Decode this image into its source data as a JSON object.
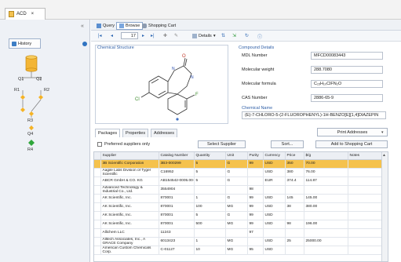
{
  "tab": {
    "title": "ACD",
    "close": "×"
  },
  "left": {
    "collapse": "«",
    "history_label": "History",
    "nodes": {
      "q1": "Q1",
      "q2": "Q2",
      "r1": "R1",
      "r2": "R2",
      "r3": "R3",
      "q4": "Q4",
      "r4": "R4"
    }
  },
  "toolbar": {
    "query": "Query",
    "browse": "Browse",
    "cart": "Shopping Cart"
  },
  "nav": {
    "first": "|◂",
    "prev": "◂",
    "page": "17",
    "next": "▸",
    "last": "▸|",
    "details": "Details"
  },
  "structure": {
    "label": "Chemical Structure"
  },
  "details": {
    "group": "Compound Details",
    "mdl_label": "MDL Number",
    "mdl_value": "MFCD00083443",
    "mw_label": "Molecular weight",
    "mw_value": "288.7080",
    "mf_label": "Molecular formula",
    "mf_value": "C₁₅H₁₀ClFN₂O",
    "cas_label": "CAS Number",
    "cas_value": "2886-65-9",
    "name_group": "Chemical Name",
    "name_value": "(E)-7-CHLORO-5-(2-FLUOROPHENYL)-1H-BENZO[E][1,4]DIAZEPIN"
  },
  "lower_tabs": {
    "packages": "Packages",
    "properties": "Properties",
    "addresses": "Addresses"
  },
  "actions": {
    "print": "Print Addresses",
    "preferred": "Preferred suppliers only",
    "select_supplier": "Select Supplier",
    "sort": "Sort...",
    "add_cart": "Add to Shopping Cart"
  },
  "table": {
    "headers": [
      "Supplier",
      "Catalog Number",
      "Quantity",
      "Unit",
      "Purity",
      "Currency",
      "Price",
      "$/g",
      "Notes"
    ],
    "rows": [
      [
        "3B Scientific Corporation",
        "3B3-000299",
        "5",
        "G",
        "99",
        "USD",
        "350",
        "70.00",
        ""
      ],
      [
        "Aagile Labs Division of Tyger Scientific",
        "C16952",
        "5",
        "G",
        "",
        "USD",
        "380",
        "76.00",
        ""
      ],
      [
        "ABCR GmbH & CO. KG",
        "AB154542-0005.00-",
        "5",
        "G",
        "",
        "EUR",
        "374.4",
        "114.87",
        ""
      ],
      [
        "Advanced Technology & Industrial Co., Ltd.",
        "3554904",
        "",
        "",
        "98",
        "",
        "",
        "",
        ""
      ],
      [
        "AK Scientific, Inc.",
        "870001",
        "1",
        "G",
        "99",
        "USD",
        "145",
        "145.00",
        ""
      ],
      [
        "AK Scientific, Inc.",
        "870001",
        "100",
        "MG",
        "99",
        "USD",
        "38",
        "380.00",
        ""
      ],
      [
        "AK Scientific, Inc.",
        "870001",
        "5",
        "G",
        "99",
        "USD",
        "",
        "",
        ""
      ],
      [
        "AK Scientific, Inc.",
        "870001",
        "500",
        "MG",
        "99",
        "USD",
        "98",
        "196.00",
        ""
      ],
      [
        "Allichem LLC",
        "11243",
        "",
        "",
        "97",
        "",
        "",
        "",
        ""
      ],
      [
        "Alltech Associates, Inc., A GRACE Company",
        "6013423",
        "1",
        "MG",
        "",
        "USD",
        "25",
        "25000.00",
        ""
      ],
      [
        "American Custom Chemicals Corp.",
        "C-01127",
        "10",
        "MG",
        "95",
        "USD",
        "",
        "",
        ""
      ]
    ]
  },
  "colors": {
    "selected_row": "#f5c24d",
    "accent": "#2f5fa7"
  }
}
